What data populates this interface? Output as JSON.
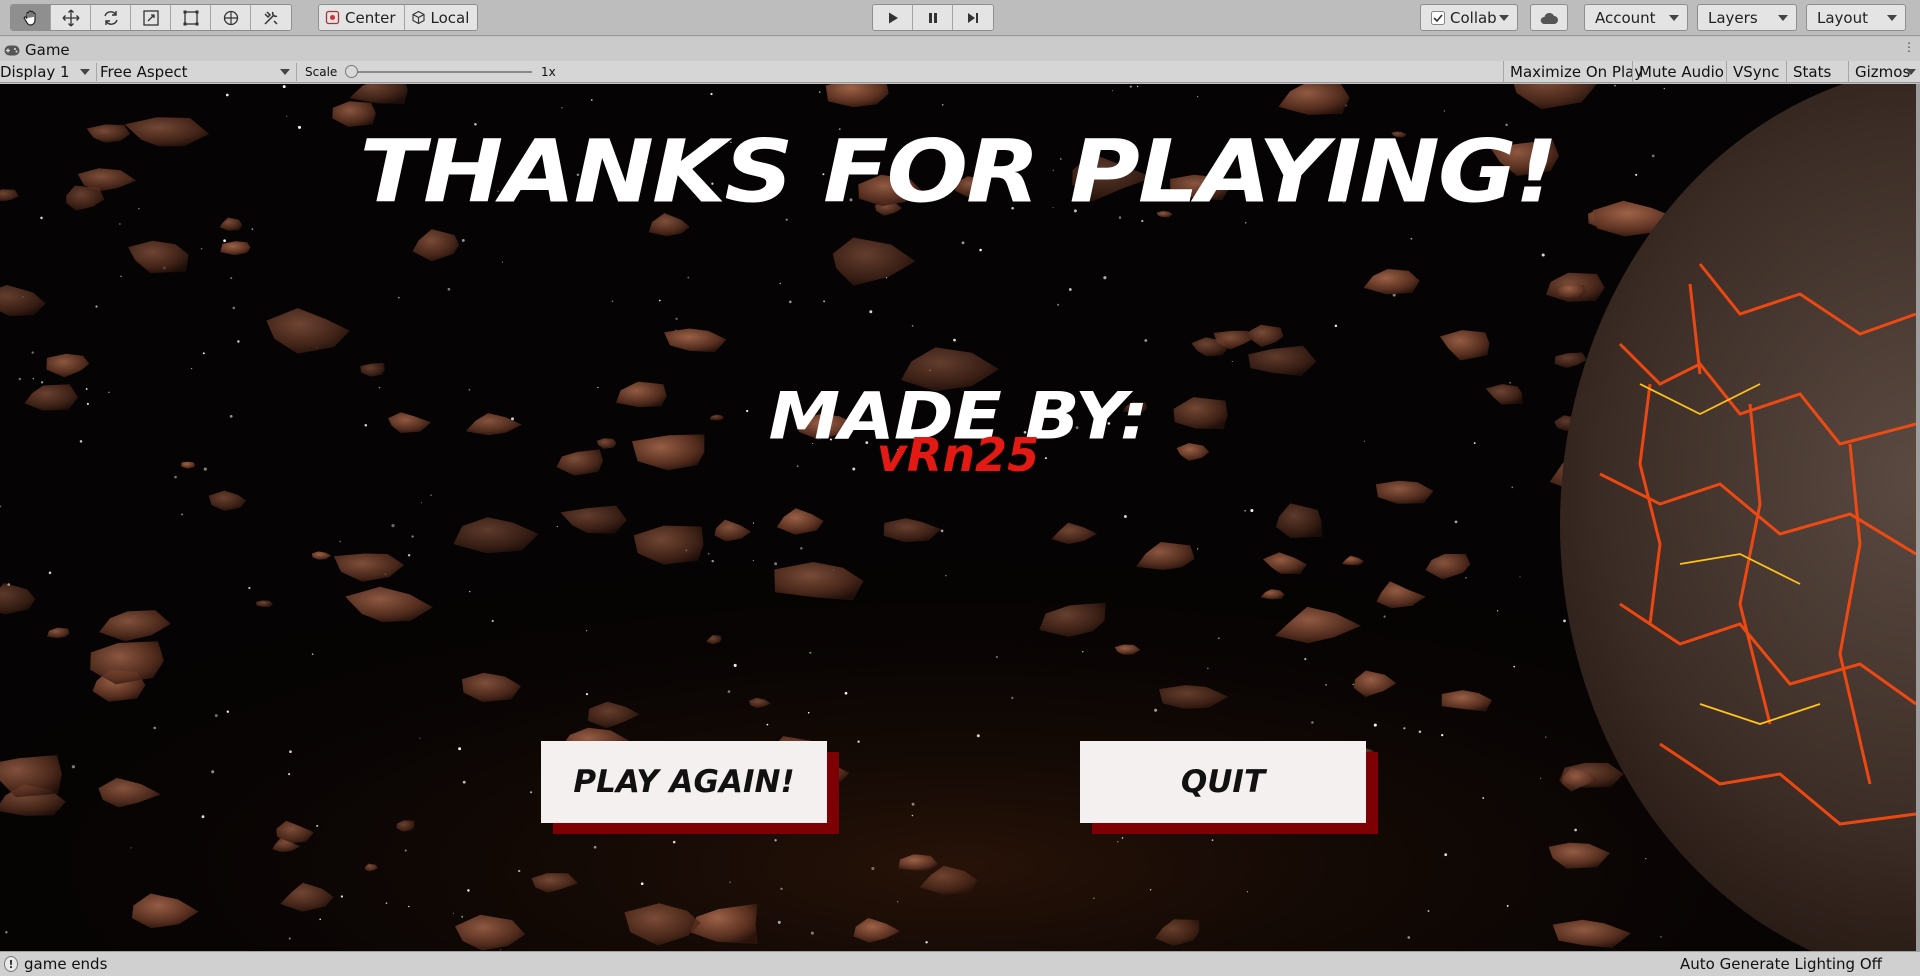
{
  "toolbar": {
    "tools": [
      "hand-tool",
      "move-tool",
      "rotate-tool",
      "scale-tool",
      "rect-tool",
      "transform-tool",
      "custom-tool"
    ],
    "pivot_label": "Center",
    "space_label": "Local",
    "collab_label": "Collab",
    "account_label": "Account",
    "layers_label": "Layers",
    "layout_label": "Layout"
  },
  "tab": {
    "label": "Game"
  },
  "gamebar": {
    "display_label": "Display 1",
    "aspect_label": "Free Aspect",
    "scale_label": "Scale",
    "scale_value": "1x",
    "maximize_label": "Maximize On Play",
    "mute_label": "Mute Audio",
    "vsync_label": "VSync",
    "stats_label": "Stats",
    "gizmos_label": "Gizmos"
  },
  "game": {
    "title": "THANKS FOR PLAYING!",
    "made_by": "MADE BY:",
    "author": "vRn25",
    "play_again_label": "PLAY AGAIN!",
    "quit_label": "QUIT",
    "accent_color": "#e31a14",
    "shadow_color": "#7c0004"
  },
  "status": {
    "message": "game ends",
    "lighting": "Auto Generate Lighting Off"
  }
}
